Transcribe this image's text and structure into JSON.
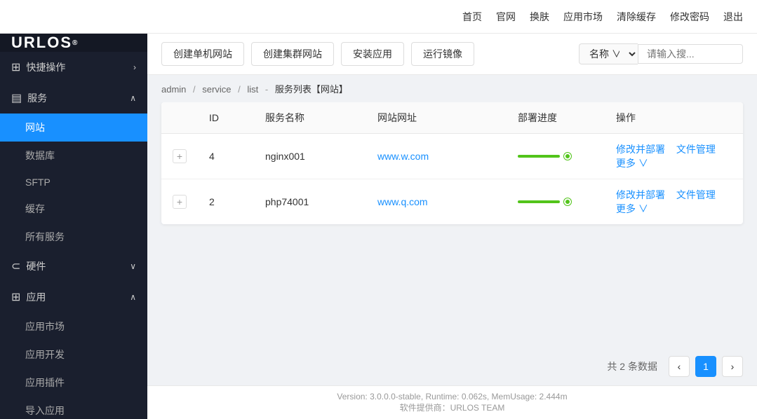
{
  "logo": {
    "text": "URLOS",
    "sup": "®"
  },
  "topnav": {
    "items": [
      {
        "label": "首页",
        "name": "home"
      },
      {
        "label": "官网",
        "name": "official"
      },
      {
        "label": "换肤",
        "name": "theme"
      },
      {
        "label": "应用市场",
        "name": "appmarket"
      },
      {
        "label": "清除缓存",
        "name": "clearcache"
      },
      {
        "label": "修改密码",
        "name": "changepassword"
      },
      {
        "label": "退出",
        "name": "logout"
      }
    ]
  },
  "sidebar": {
    "quick_ops_label": "快捷操作",
    "service_label": "服务",
    "service_items": [
      {
        "label": "网站",
        "active": true
      },
      {
        "label": "数据库"
      },
      {
        "label": "SFTP"
      },
      {
        "label": "缓存"
      },
      {
        "label": "所有服务"
      }
    ],
    "hardware_label": "硬件",
    "app_label": "应用",
    "app_items": [
      {
        "label": "应用市场"
      },
      {
        "label": "应用开发"
      },
      {
        "label": "应用插件"
      },
      {
        "label": "导入应用"
      }
    ]
  },
  "toolbar": {
    "buttons": [
      {
        "label": "创建单机网站",
        "name": "create-single"
      },
      {
        "label": "创建集群网站",
        "name": "create-cluster"
      },
      {
        "label": "安装应用",
        "name": "install-app"
      },
      {
        "label": "运行镜像",
        "name": "run-mirror"
      }
    ],
    "search_select_label": "名称",
    "search_placeholder": "请输入搜..."
  },
  "breadcrumb": {
    "items": [
      "admin",
      "service",
      "list"
    ],
    "current": "服务列表【网站】"
  },
  "table": {
    "columns": [
      "",
      "ID",
      "服务名称",
      "网站网址",
      "部署进度",
      "操作"
    ],
    "rows": [
      {
        "id": "4",
        "name": "nginx001",
        "url": "www.w.com",
        "deploy_status": "done",
        "actions": [
          "修改并部署",
          "文件管理",
          "更多"
        ]
      },
      {
        "id": "2",
        "name": "php74001",
        "url": "www.q.com",
        "deploy_status": "done",
        "actions": [
          "修改并部署",
          "文件管理",
          "更多"
        ]
      }
    ]
  },
  "pagination": {
    "total_text": "共 2 条数据",
    "current_page": "1"
  },
  "footer": {
    "line1": "Version: 3.0.0.0-stable,  Runtime: 0.062s,  MemUsage: 2.444m",
    "line2": "软件提供商：URLOS TEAM"
  }
}
